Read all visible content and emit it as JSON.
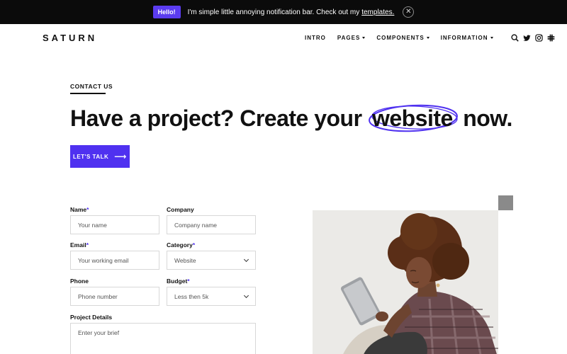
{
  "notification": {
    "badge": "Hello!",
    "text": "I'm simple little annoying notification bar. Check out my",
    "link": "templates.",
    "close_icon": "close-icon"
  },
  "header": {
    "logo": "SATURN",
    "nav": [
      {
        "label": "INTRO",
        "has_dropdown": false
      },
      {
        "label": "PAGES",
        "has_dropdown": true
      },
      {
        "label": "COMPONENTS",
        "has_dropdown": true
      },
      {
        "label": "INFORMATION",
        "has_dropdown": true
      }
    ],
    "icons": [
      "search-icon",
      "twitter-icon",
      "instagram-icon",
      "slack-icon"
    ]
  },
  "hero": {
    "eyebrow": "CONTACT US",
    "headline_before": "Have a project? Create your",
    "headline_highlight": "website",
    "headline_after": "now.",
    "cta_label": "LET'S TALK",
    "cta_arrow": "⟶"
  },
  "form": {
    "name": {
      "label": "Name",
      "placeholder": "Your name",
      "required": "*"
    },
    "company": {
      "label": "Company",
      "placeholder": "Company name"
    },
    "email": {
      "label": "Email",
      "placeholder": "Your working email",
      "required": "*"
    },
    "category": {
      "label": "Category",
      "value": "Website",
      "required": "*"
    },
    "phone": {
      "label": "Phone",
      "placeholder": "Phone number"
    },
    "budget": {
      "label": "Budget",
      "value": "Less then 5k",
      "required": "*"
    },
    "details": {
      "label": "Project Details",
      "placeholder": "Enter your brief"
    }
  },
  "colors": {
    "accent": "#4f31f0",
    "notification_bg": "#0b0b0b",
    "text": "#111111"
  }
}
